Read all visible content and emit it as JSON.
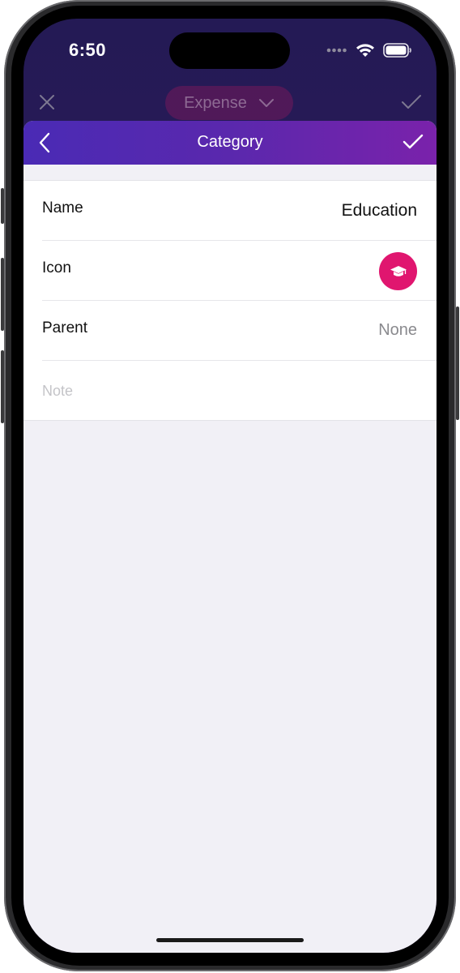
{
  "status_bar": {
    "time": "6:50",
    "signal_icon": "signal-dots-icon",
    "wifi_icon": "wifi-icon",
    "battery_icon": "battery-icon"
  },
  "background_screen": {
    "title": "Expense",
    "close_icon": "close-icon",
    "dropdown_icon": "chevron-down-icon",
    "confirm_icon": "checkmark-icon"
  },
  "nav": {
    "title": "Category",
    "back_icon": "chevron-left-icon",
    "done_icon": "checkmark-icon",
    "gradient": [
      "#4a2ab5",
      "#7a22ab"
    ]
  },
  "form": {
    "name": {
      "label": "Name",
      "value": "Education"
    },
    "icon": {
      "label": "Icon",
      "icon_name": "graduation-cap-icon",
      "color": "#e0166f"
    },
    "parent": {
      "label": "Parent",
      "value": "None"
    },
    "note": {
      "placeholder": "Note"
    }
  }
}
